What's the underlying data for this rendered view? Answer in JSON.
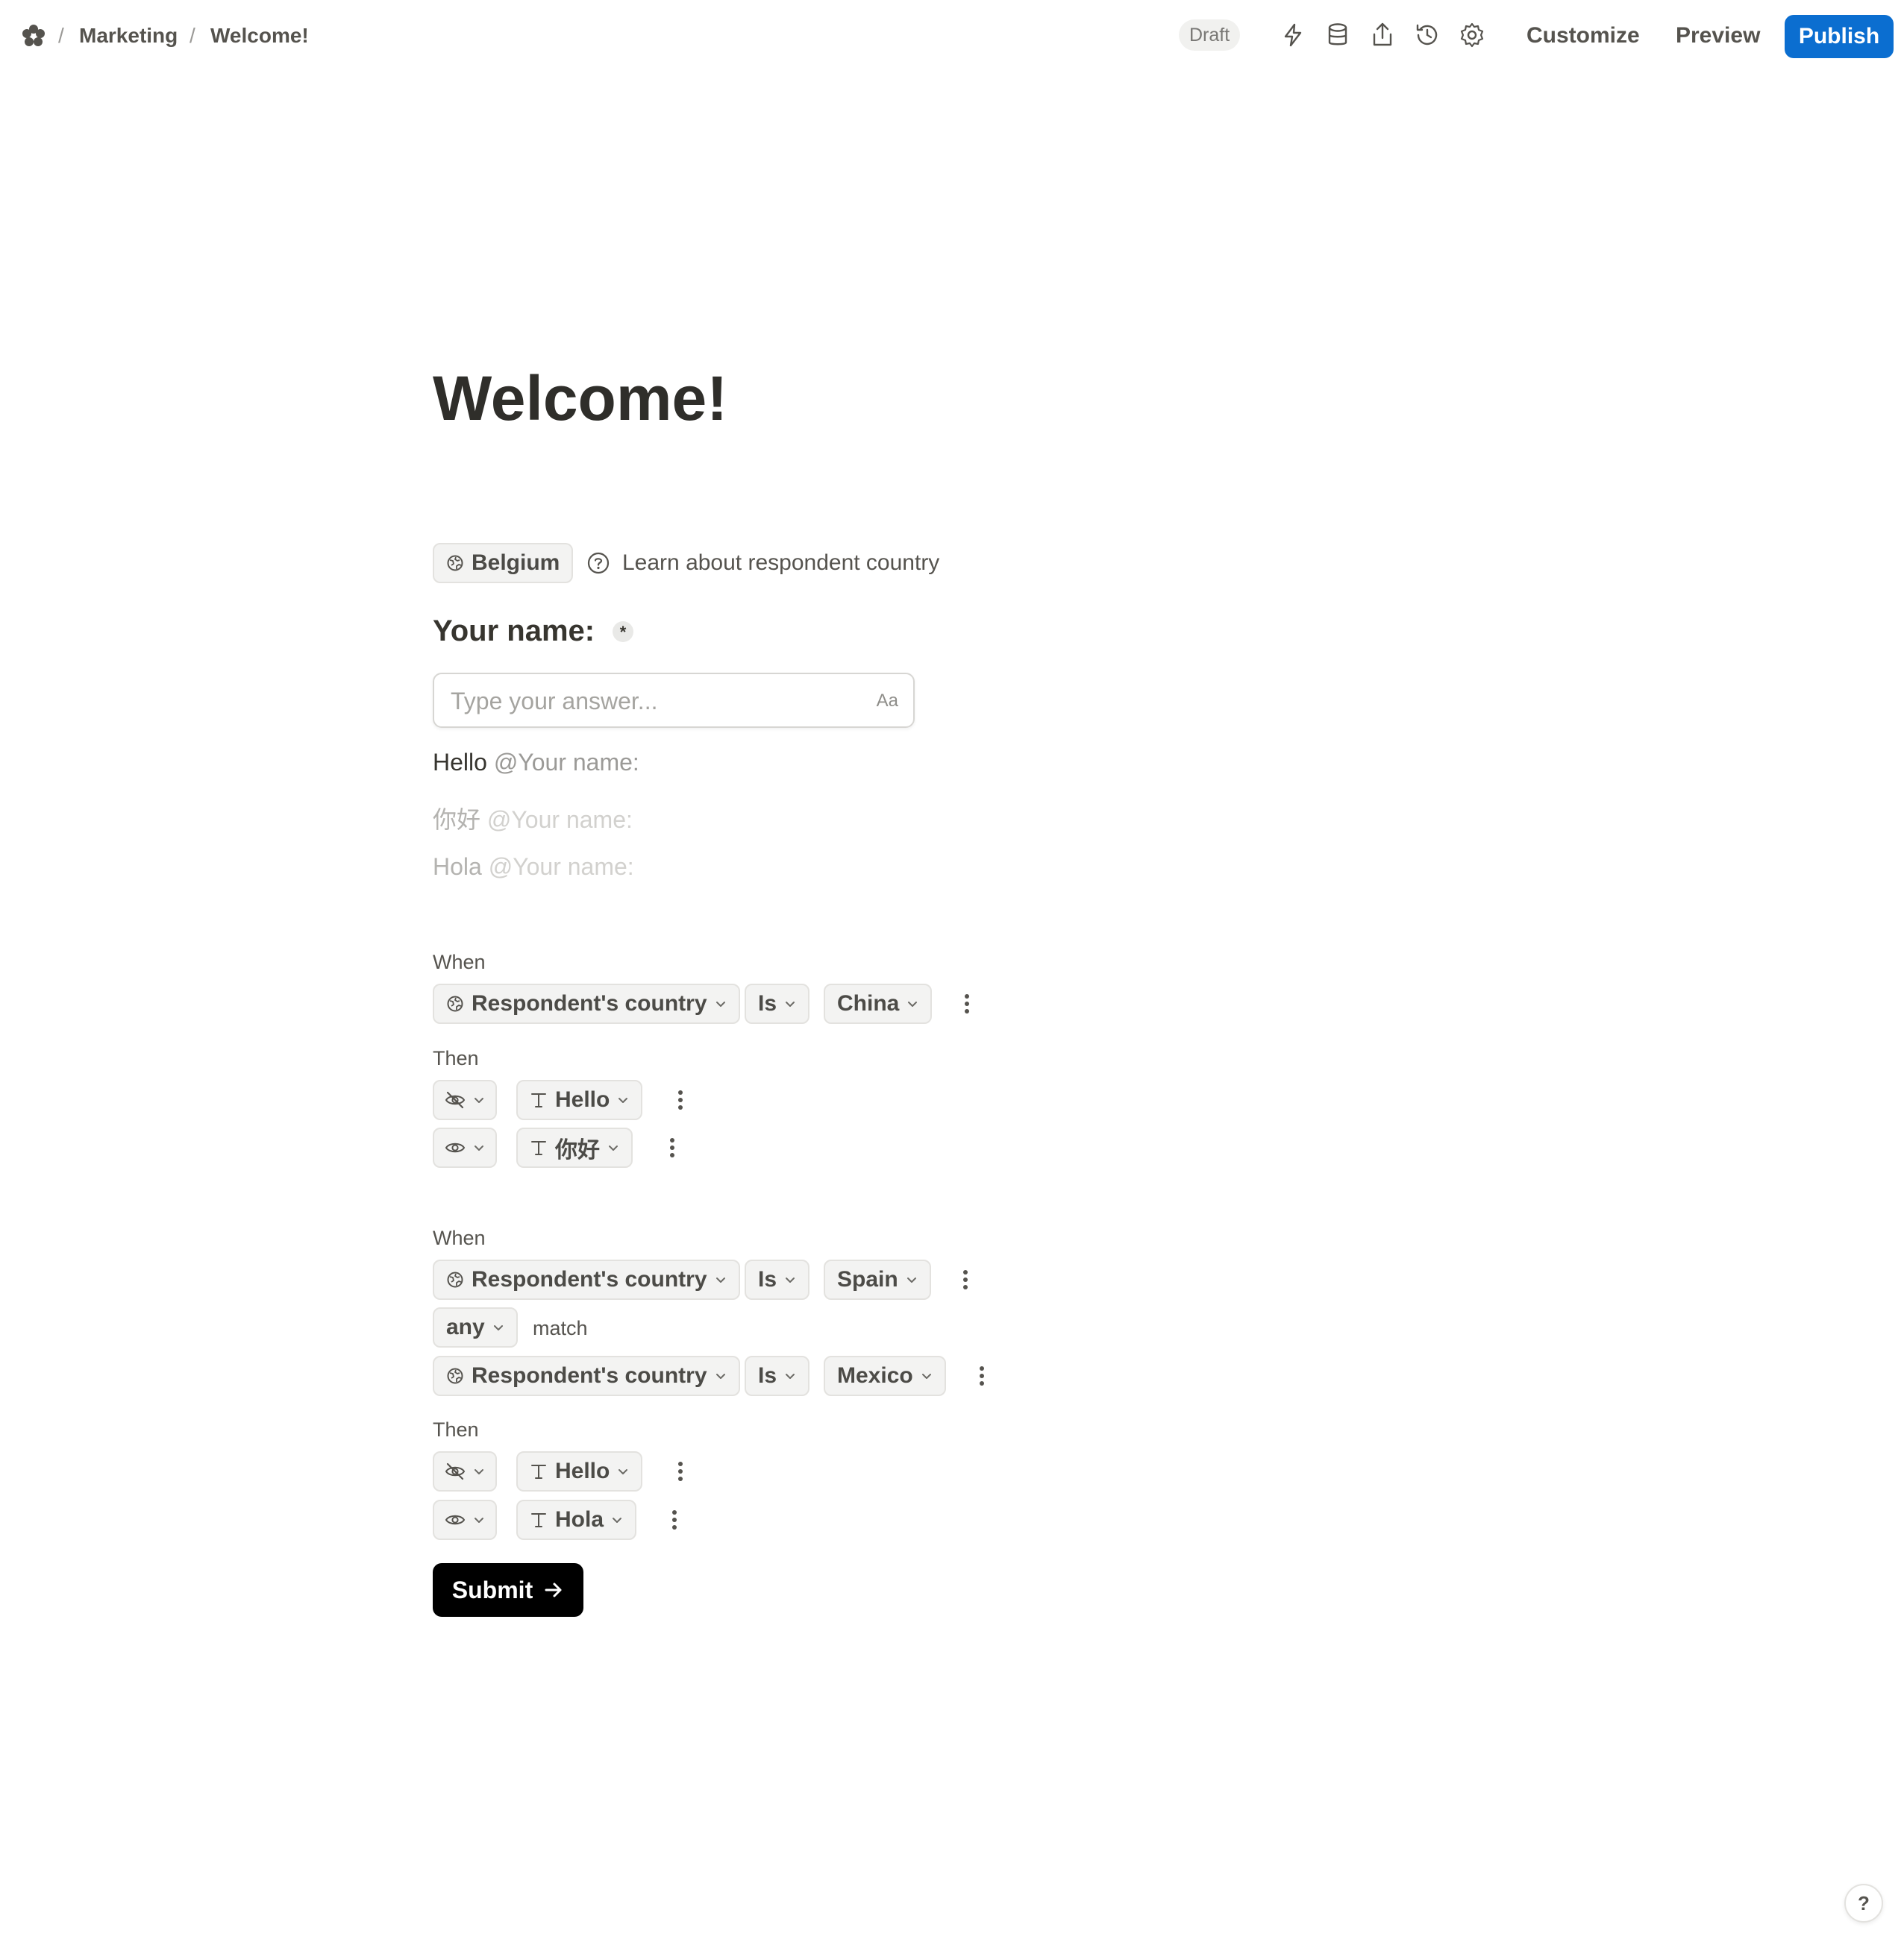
{
  "breadcrumb": {
    "items": [
      "Marketing",
      "Welcome!"
    ],
    "separator": "/"
  },
  "topbar": {
    "status": "Draft",
    "customize": "Customize",
    "preview": "Preview",
    "publish": "Publish"
  },
  "icons": [
    "workspace-logo-icon",
    "lightning-icon",
    "database-icon",
    "share-icon",
    "history-icon",
    "gear-icon",
    "globe-icon",
    "help-circle-icon",
    "eye-off-icon",
    "eye-icon",
    "text-icon",
    "chevron-down-icon",
    "more-vertical-icon",
    "arrow-right-icon"
  ],
  "page": {
    "title": "Welcome!",
    "country_chip": "Belgium",
    "learn_link": "Learn about respondent country",
    "question_label": "Your name:",
    "required_mark": "*",
    "answer_placeholder": "Type your answer...",
    "text_format_icon": "Aa",
    "greetings": [
      {
        "word": "Hello",
        "mention": "@Your name:"
      },
      {
        "word": "你好",
        "mention": "@Your name:"
      },
      {
        "word": "Hola",
        "mention": "@Your name:"
      }
    ]
  },
  "logic": [
    {
      "when_label": "When",
      "condition": {
        "field": "Respondent's country",
        "operator": "Is",
        "value": "China"
      },
      "then_label": "Then",
      "actions": [
        {
          "visibility": "hide",
          "target": "Hello"
        },
        {
          "visibility": "show",
          "target": "你好"
        }
      ]
    },
    {
      "when_label": "When",
      "condition": {
        "field": "Respondent's country",
        "operator": "Is",
        "value": "Spain"
      },
      "match_mode": "any",
      "match_label": "match",
      "condition2": {
        "field": "Respondent's country",
        "operator": "Is",
        "value": "Mexico"
      },
      "then_label": "Then",
      "actions": [
        {
          "visibility": "hide",
          "target": "Hello"
        },
        {
          "visibility": "show",
          "target": "Hola"
        }
      ]
    }
  ],
  "submit": {
    "label": "Submit"
  },
  "help": {
    "label": "?"
  },
  "colors": {
    "accent": "#0b6ed0",
    "submit_bg": "#000000",
    "text": "#37352f",
    "muted": "#a5a4a0"
  }
}
